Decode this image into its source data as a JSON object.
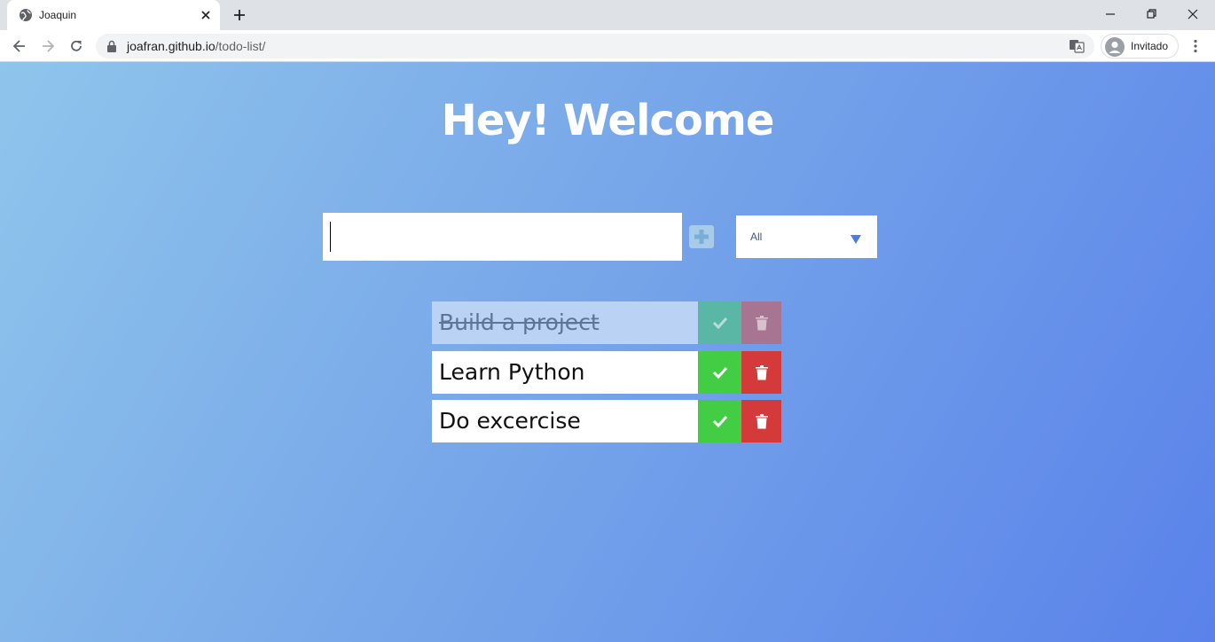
{
  "browser": {
    "tab_title": "Joaquin",
    "url_host": "joafran.github.io",
    "url_path": "/todo-list/",
    "profile_name": "Invitado"
  },
  "page": {
    "heading": "Hey! Welcome",
    "input_value": "",
    "filter_selected": "All",
    "todos": [
      {
        "text": "Build a project",
        "completed": true
      },
      {
        "text": "Learn Python",
        "completed": false
      },
      {
        "text": "Do excercise",
        "completed": false
      }
    ]
  },
  "colors": {
    "check": "#43cd45",
    "trash": "#d43a3a",
    "gradient_start": "#8fc5ec",
    "gradient_end": "#5a82ea"
  }
}
